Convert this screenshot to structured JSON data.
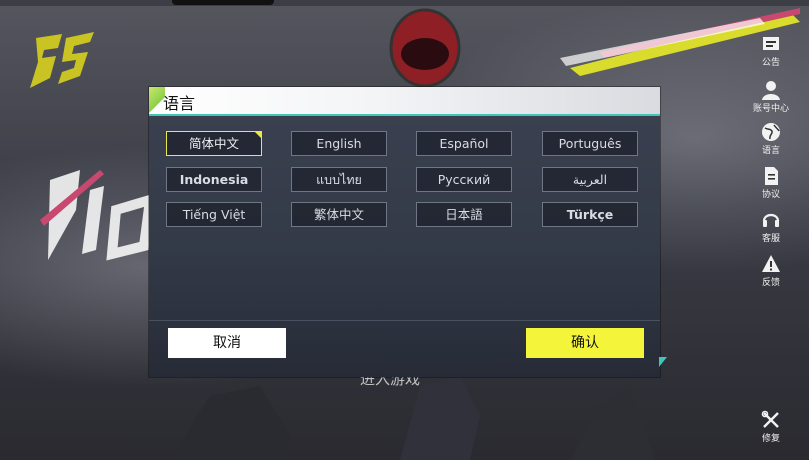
{
  "colors": {
    "accent_yellow": "#f4f53a",
    "teal": "#3fc6b8",
    "selected_border": "#e8e84a"
  },
  "background": {
    "enter_text": "进入游戏"
  },
  "side_menu": [
    {
      "label": "公告",
      "icon": "notice-board-icon"
    },
    {
      "label": "账号中心",
      "icon": "user-icon"
    },
    {
      "label": "语言",
      "icon": "globe-icon"
    },
    {
      "label": "协议",
      "icon": "document-icon"
    },
    {
      "label": "客服",
      "icon": "headset-icon"
    },
    {
      "label": "反馈",
      "icon": "warning-icon"
    },
    {
      "label": "修复",
      "icon": "wrench-icon"
    }
  ],
  "modal": {
    "title": "语言",
    "languages": [
      "简体中文",
      "English",
      "Español",
      "Português",
      "Indonesia",
      "แบบไทย",
      "Русский",
      "العربية",
      "Tiếng Việt",
      "繁体中文",
      "日本語",
      "Türkçe"
    ],
    "selected_language": "简体中文",
    "cancel_label": "取消",
    "confirm_label": "确认"
  }
}
